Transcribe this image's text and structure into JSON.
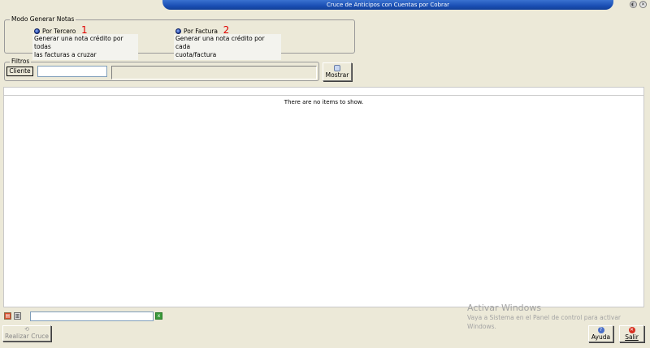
{
  "window": {
    "title": "Cruce de Anticipos con Cuentas por Cobrar",
    "controls": [
      "◐",
      "✕"
    ]
  },
  "modo": {
    "legend": "Modo Generar Notas",
    "option1": {
      "label": "Por Tercero",
      "mark": "1",
      "desc_line1": "Generar una nota crédito por todas",
      "desc_line2": "las facturas a cruzar"
    },
    "option2": {
      "label": "Por Factura",
      "mark": "2",
      "desc_line1": "Generar una nota crédito por cada",
      "desc_line2": "cuota/factura"
    }
  },
  "filtros": {
    "legend": "Filtros",
    "cliente_button": "Cliente",
    "cliente_value": "",
    "cliente_name": "",
    "mostrar_button": "Mostrar"
  },
  "grid": {
    "empty_message": "There are no items to show."
  },
  "footer": {
    "search_value": "",
    "realizar_cruce": "Realizar Cruce",
    "ayuda": "Ayuda",
    "salir": "Salir"
  },
  "watermark": {
    "title": "Activar Windows",
    "line1": "Vaya a Sistema en el Panel de control para activar",
    "line2": "Windows."
  },
  "colors": {
    "title_bar": "#1a4fb4",
    "window_bg": "#ece9d8",
    "annotation_red": "#e00000"
  }
}
